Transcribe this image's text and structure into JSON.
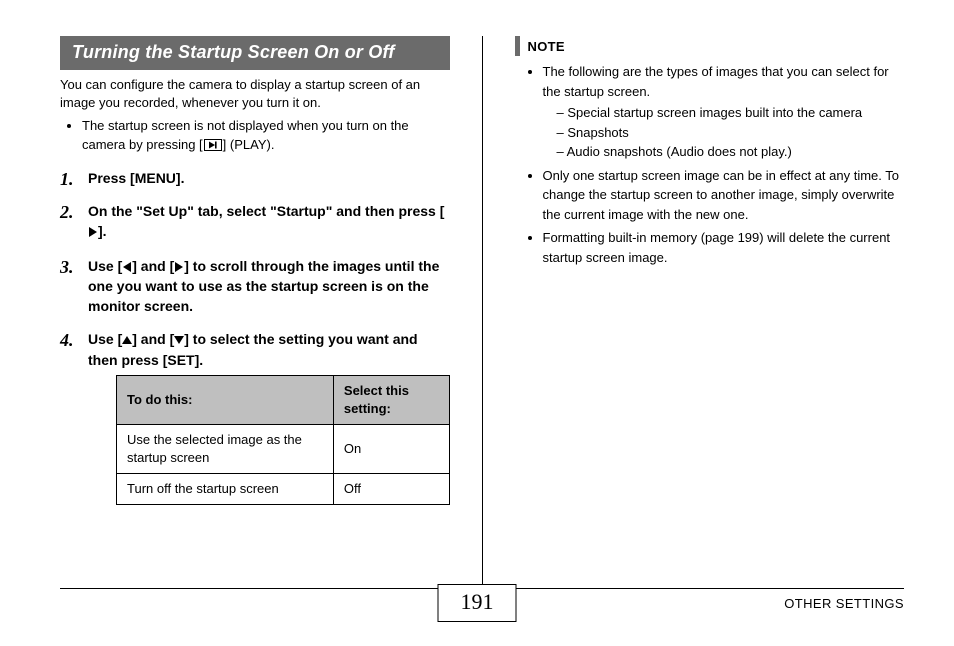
{
  "heading": "Turning the Startup Screen On or Off",
  "intro": "You can configure the camera to display a startup screen of an image you recorded, whenever you turn it on.",
  "intro_bullet_parts": {
    "before": "The startup screen is not displayed when you turn on the camera by pressing [",
    "after": "] (PLAY)."
  },
  "steps": {
    "s1": "Press [MENU].",
    "s2_a": "On the \"Set Up\" tab, select \"Startup\" and then press [",
    "s2_b": "].",
    "s3_a": "Use [",
    "s3_b": "] and [",
    "s3_c": "] to scroll through the images until the one you want to use as the startup screen is on the monitor screen.",
    "s4_a": "Use [",
    "s4_b": "] and [",
    "s4_c": "] to select the setting you want and then press [SET]."
  },
  "table": {
    "head_left": "To do this:",
    "head_right": "Select this setting:",
    "rows": [
      {
        "left": "Use the selected image as the startup screen",
        "right": "On"
      },
      {
        "left": "Turn off the startup screen",
        "right": "Off"
      }
    ]
  },
  "note_label": "NOTE",
  "note": {
    "b1": "The following are the types of images that you can select for the startup screen.",
    "b1_sub": [
      "Special startup screen images built into the camera",
      "Snapshots",
      "Audio snapshots (Audio does not play.)"
    ],
    "b2": "Only one startup screen image can be in effect at any time. To change the startup screen to another image, simply overwrite the current image with the new one.",
    "b3": "Formatting built-in memory (page 199) will delete the current startup screen image."
  },
  "page_number": "191",
  "footer_label": "OTHER SETTINGS"
}
